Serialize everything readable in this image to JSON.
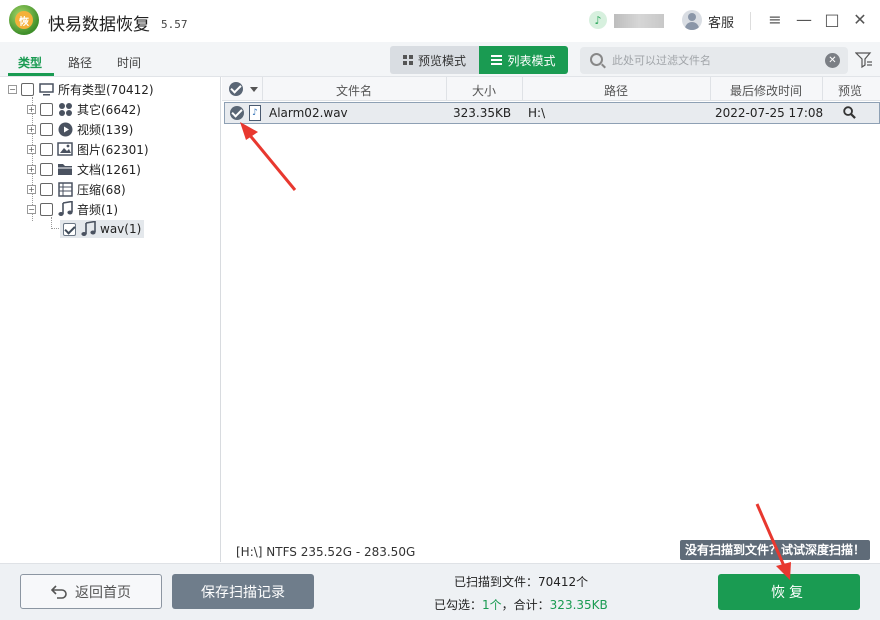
{
  "app": {
    "title": "快易数据恢复",
    "version": "5.57",
    "logo_char": "恢"
  },
  "topbar": {
    "service_label": "客服",
    "menu_icon": "≡",
    "minimize_icon": "—",
    "maximize_icon": "□",
    "close_icon": "✕"
  },
  "tabs": [
    {
      "label": "类型"
    },
    {
      "label": "路径"
    },
    {
      "label": "时间"
    }
  ],
  "view_modes": {
    "preview_label": "预览模式",
    "list_label": "列表模式"
  },
  "search": {
    "placeholder": "此处可以过滤文件名"
  },
  "tree": {
    "root": "所有类型(70412)",
    "items": [
      {
        "label": "其它(6642)",
        "icon": "apps-icon"
      },
      {
        "label": "视频(139)",
        "icon": "video-icon"
      },
      {
        "label": "图片(62301)",
        "icon": "image-icon"
      },
      {
        "label": "文档(1261)",
        "icon": "folder-icon"
      },
      {
        "label": "压缩(68)",
        "icon": "archive-icon"
      },
      {
        "label": "音频(1)",
        "icon": "music-icon"
      }
    ],
    "child": {
      "label": "wav(1)",
      "icon": "music-icon"
    }
  },
  "table": {
    "columns": {
      "name": "文件名",
      "size": "大小",
      "path": "路径",
      "modified": "最后修改时间",
      "preview": "预览"
    },
    "rows": [
      {
        "name": "Alarm02.wav",
        "size": "323.35KB",
        "path": "H:\\",
        "modified": "2022-07-25   17:08"
      }
    ]
  },
  "drive_info": "[H:\\] NTFS 235.52G - 283.50G",
  "deep_scan": "没有扫描到文件？试试深度扫描！",
  "footer": {
    "home_label": "返回首页",
    "save_label": "保存扫描记录",
    "scanned": "已扫描到文件：70412个",
    "selected_prefix": "已勾选：",
    "selected_count": "1个",
    "selected_mid": "，合计：",
    "selected_total": "323.35KB",
    "recover_label": "恢复"
  },
  "colors": {
    "accent": "#1a9b52",
    "annotation": "#e8382f"
  }
}
